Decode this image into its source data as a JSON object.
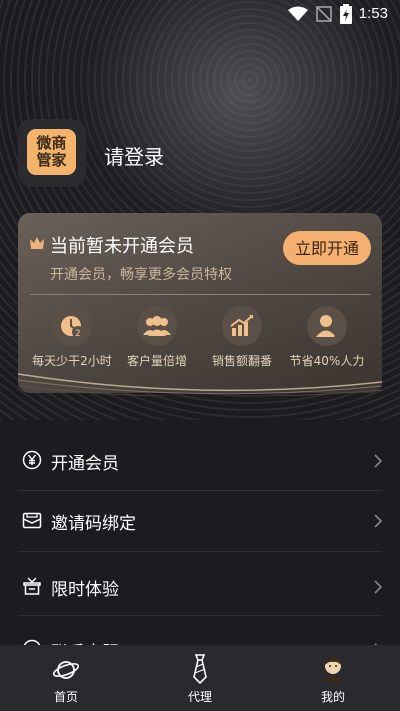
{
  "status_bar": {
    "time": "1:53"
  },
  "profile": {
    "logo_text": "微商管家",
    "login_label": "请登录"
  },
  "vip": {
    "title": "当前暂未开通会员",
    "subtitle": "开通会员，畅享更多会员特权",
    "open_button": "立即开通",
    "benefits": [
      {
        "label": "每天少干2小时",
        "icon": "clock-2-icon"
      },
      {
        "label": "客户量倍增",
        "icon": "users-icon"
      },
      {
        "label": "销售额翻番",
        "icon": "chart-up-icon"
      },
      {
        "label": "节省40%人力",
        "icon": "person-icon"
      }
    ]
  },
  "menu": [
    {
      "label": "开通会员",
      "icon": "yuan-icon"
    },
    {
      "label": "邀请码绑定",
      "icon": "envelope-icon"
    },
    {
      "label": "限时体验",
      "icon": "gift-box-icon"
    },
    {
      "label": "联系客服",
      "icon": "headset-icon"
    }
  ],
  "tabs": [
    {
      "label": "首页",
      "icon": "planet-icon"
    },
    {
      "label": "代理",
      "icon": "tie-icon"
    },
    {
      "label": "我的",
      "icon": "user-avatar-icon"
    }
  ],
  "colors": {
    "accent": "#f3b070",
    "background": "#1c1c20",
    "card": "#4e4640"
  }
}
